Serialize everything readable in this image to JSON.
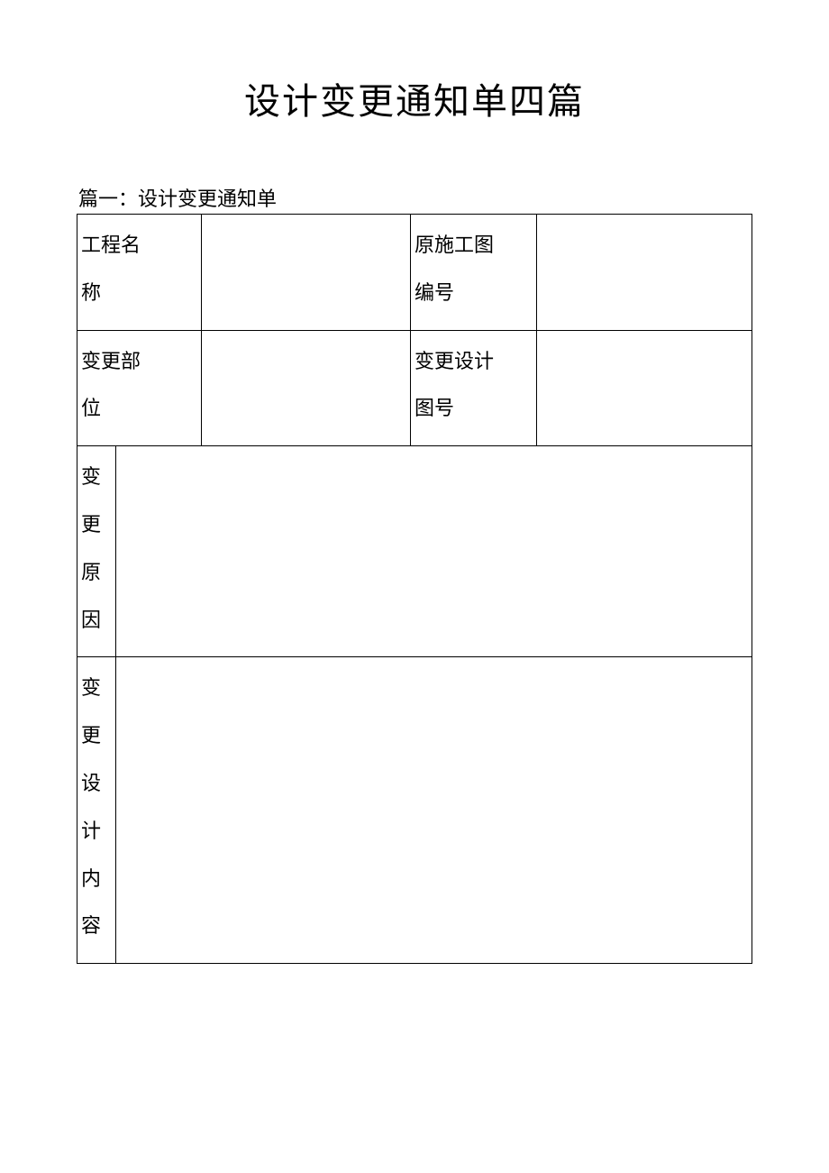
{
  "title": "设计变更通知单四篇",
  "subtitle": "篇一：设计变更通知单",
  "rows": {
    "r1": {
      "label1": "工程名称",
      "value1": "",
      "label2": "原施工图编号",
      "value2": ""
    },
    "r2": {
      "label1": "变更部位",
      "value1": "",
      "label2": "变更设计图号",
      "value2": ""
    },
    "r3": {
      "label": "变更原因",
      "value": ""
    },
    "r4": {
      "label": "变更设计内容",
      "value": ""
    }
  }
}
